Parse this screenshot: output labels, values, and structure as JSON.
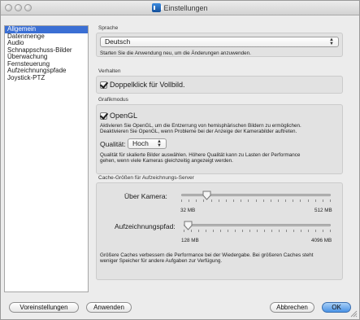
{
  "window": {
    "title": "Einstellungen"
  },
  "sidebar": {
    "items": [
      {
        "label": "Allgemein",
        "selected": true
      },
      {
        "label": "Datenmenge"
      },
      {
        "label": "Audio"
      },
      {
        "label": "Schnappschuss-Bilder"
      },
      {
        "label": "Überwachung"
      },
      {
        "label": "Fernsteuerung"
      },
      {
        "label": "Aufzeichnungspfade"
      },
      {
        "label": "Joystick-PTZ"
      }
    ]
  },
  "language": {
    "section_label": "Sprache",
    "selected": "Deutsch",
    "hint": "Starten Sie die Anwendung neu, um die Änderungen anzuwenden."
  },
  "behavior": {
    "section_label": "Verhalten",
    "doubleclick_label": "Doppelklick für Vollbild.",
    "doubleclick_checked": true
  },
  "graphics": {
    "section_label": "Grafikmodus",
    "opengl_label": "OpenGL",
    "opengl_checked": true,
    "opengl_hint_1": "Aktivieren Sie OpenGL, um die Entzerrung von hemisphärischen Bildern zu ermöglichen.",
    "opengl_hint_2": "Deaktivieren Sie OpenGL, wenn Probleme bei der Anzeige der Kamerabilder auftreten.",
    "quality_label": "Qualität:",
    "quality_value": "Hoch",
    "quality_hint_1": "Qualität für skalierte Bilder auswählen. Höhere Qualität kann zu Lasten der Performance",
    "quality_hint_2": "gehen, wenn viele Kameras gleichzeitig angezeigt werden."
  },
  "cache": {
    "section_label": "Cache-Größen für Aufzeichnungs-Server",
    "camera_label": "Über Kamera:",
    "camera_min": "32 MB",
    "camera_max": "512 MB",
    "camera_fraction": 0.17,
    "recpath_label": "Aufzeichnungspfad:",
    "recpath_min": "128 MB",
    "recpath_max": "4096 MB",
    "recpath_fraction": 0.03,
    "hint_1": "Größere Caches verbessern die Performance bei der Wiedergabe. Bei größeren Caches steht",
    "hint_2": "weniger Speicher für andere Aufgaben zur Verfügung."
  },
  "buttons": {
    "defaults": "Voreinstellungen",
    "apply": "Anwenden",
    "cancel": "Abbrechen",
    "ok": "OK"
  },
  "colors": {
    "accent": "#3b6fd4",
    "ok_button": "#4a93e6"
  }
}
